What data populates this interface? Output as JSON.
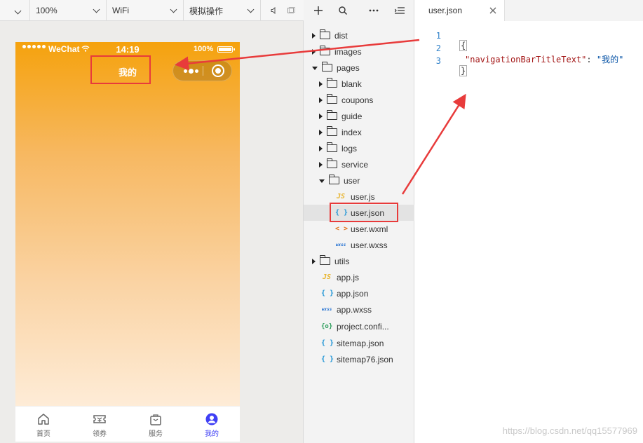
{
  "toolbar": {
    "zoom": "100%",
    "network": "WiFi",
    "operation": "模拟操作"
  },
  "phone": {
    "carrier": "WeChat",
    "time": "14:19",
    "battery": "100%",
    "nav_title": "我的",
    "tabs": [
      {
        "label": "首页",
        "icon": "home-icon",
        "active": false
      },
      {
        "label": "领券",
        "icon": "ticket-icon",
        "active": false
      },
      {
        "label": "服务",
        "icon": "bag-icon",
        "active": false
      },
      {
        "label": "我的",
        "icon": "user-icon",
        "active": true
      }
    ]
  },
  "explorer": {
    "items": [
      {
        "label": "dist",
        "type": "folder"
      },
      {
        "label": "images",
        "type": "folder"
      },
      {
        "label": "pages",
        "type": "folder"
      },
      {
        "label": "blank",
        "type": "folder"
      },
      {
        "label": "coupons",
        "type": "folder"
      },
      {
        "label": "guide",
        "type": "folder"
      },
      {
        "label": "index",
        "type": "folder"
      },
      {
        "label": "logs",
        "type": "folder"
      },
      {
        "label": "service",
        "type": "folder"
      },
      {
        "label": "user",
        "type": "folder"
      },
      {
        "label": "user.js",
        "type": "js",
        "badge": "JS"
      },
      {
        "label": "user.json",
        "type": "json",
        "badge": "{ }",
        "selected": true
      },
      {
        "label": "user.wxml",
        "type": "wxml",
        "badge": "< >"
      },
      {
        "label": "user.wxss",
        "type": "wxss",
        "badge": "wxss"
      },
      {
        "label": "utils",
        "type": "folder"
      },
      {
        "label": "app.js",
        "type": "js",
        "badge": "JS"
      },
      {
        "label": "app.json",
        "type": "json",
        "badge": "{ }"
      },
      {
        "label": "app.wxss",
        "type": "wxss",
        "badge": "wxss"
      },
      {
        "label": "project.confi...",
        "type": "config",
        "badge": "{o}"
      },
      {
        "label": "sitemap.json",
        "type": "json",
        "badge": "{ }"
      },
      {
        "label": "sitemap76.json",
        "type": "json",
        "badge": "{ }"
      }
    ]
  },
  "editor": {
    "tab_label": "user.json",
    "lines": [
      {
        "num": "1",
        "open": "{"
      },
      {
        "num": "2",
        "key": "\"navigationBarTitleText\"",
        "sep": ": ",
        "value": "\"我的\""
      },
      {
        "num": "3",
        "close": "}"
      }
    ]
  },
  "watermark": "https://blog.csdn.net/qq15577969",
  "colors": {
    "highlight": "#e83b3b",
    "nav_bar": "#f5a20d",
    "active_tab": "#3f3ff5"
  }
}
